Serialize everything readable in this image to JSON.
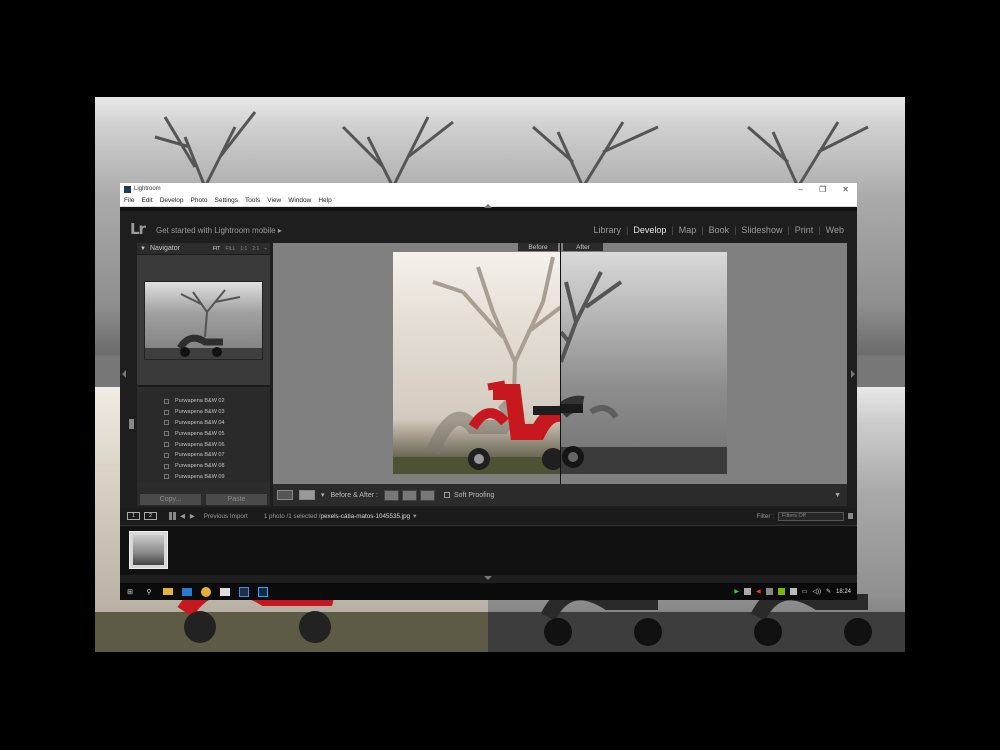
{
  "window": {
    "title": "Lightroom",
    "controls": [
      "–",
      "❐",
      "✕"
    ]
  },
  "menu": [
    "File",
    "Edit",
    "Develop",
    "Photo",
    "Settings",
    "Tools",
    "View",
    "Window",
    "Help"
  ],
  "topbar": {
    "logo": "Lr",
    "mobile_prompt": "Get started with Lightroom mobile",
    "mobile_arrow": "▸",
    "modules": [
      "Library",
      "Develop",
      "Map",
      "Book",
      "Slideshow",
      "Print",
      "Web"
    ],
    "active_module": "Develop"
  },
  "navigator": {
    "title": "Navigator",
    "zoom_options": [
      "FIT",
      "FILL",
      "1:1",
      "2:1"
    ],
    "zoom_selected": "FIT"
  },
  "presets": [
    "Purwapena B&W 02",
    "Purwapena B&W 03",
    "Purwapena B&W 04",
    "Purwapena B&W 05",
    "Purwapena B&W 06",
    "Purwapena B&W 07",
    "Purwapena B&W 08",
    "Purwapena B&W 09"
  ],
  "buttons": {
    "copy": "Copy...",
    "paste": "Paste"
  },
  "view": {
    "before_label": "Before",
    "after_label": "After"
  },
  "toolbar": {
    "before_after_label": "Before & After :",
    "soft_proofing": "Soft Proofing",
    "dropdown_arrow": "▼"
  },
  "filmstrip_bar": {
    "monitor_1": "1",
    "monitor_2": "2",
    "source": "Previous Import",
    "count": "1 photo /1 selected /",
    "filename": "pexels-cátia-matos-1045535.jpg",
    "filter_label": "Filter :",
    "filter_value": "Filters Off"
  },
  "taskbar": {
    "time": "18:24"
  },
  "colors": {
    "accent_active": "#e6e6e6",
    "panel_bg": "#2c2c2c",
    "canvas_gray": "#808080",
    "scooter_red": "#c8181f"
  }
}
